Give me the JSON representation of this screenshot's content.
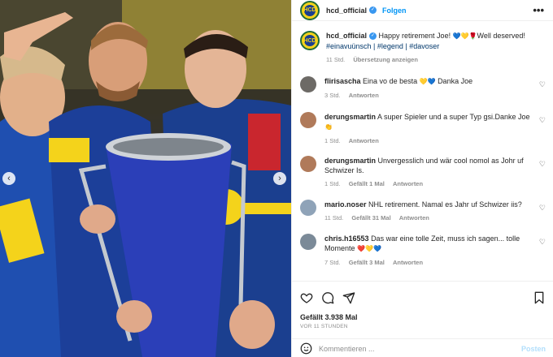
{
  "account": {
    "username": "hcd_official",
    "follow_label": "Folgen",
    "more_label": "•••",
    "avatar_initials": "HCD"
  },
  "photo": {
    "alt": "Hockey players celebrating with trophy",
    "prev_label": "‹",
    "next_label": "›"
  },
  "caption": {
    "username": "hcd_official",
    "text": "Happy retirement Joe!",
    "emojis": "💙💛🌹",
    "text2": "Well deserved!",
    "hashtags": "#einavuünsch | #legend | #davoser",
    "time": "11 Std.",
    "translate_label": "Übersetzung anzeigen"
  },
  "comments": [
    {
      "username": "flirisascha",
      "text": "Eina vo de besta",
      "emojis": "💛💙",
      "text2": "Danka Joe",
      "time": "3 Std.",
      "likes": "",
      "reply_label": "Antworten"
    },
    {
      "username": "derungsmartin",
      "text": "A super Spieler und a super Typ gsi.Danke Joe",
      "emojis": "👏",
      "text2": "",
      "time": "1 Std.",
      "likes": "",
      "reply_label": "Antworten"
    },
    {
      "username": "derungsmartin",
      "text": "Unvergesslich und wär cool nomol as Johr uf Schwizer Is.",
      "emojis": "",
      "text2": "",
      "time": "1 Std.",
      "likes": "Gefällt 1 Mal",
      "reply_label": "Antworten"
    },
    {
      "username": "mario.noser",
      "text": "NHL retirement. Namal es Jahr uf Schwizer iis?",
      "emojis": "",
      "text2": "",
      "time": "11 Std.",
      "likes": "Gefällt 31 Mal",
      "reply_label": "Antworten"
    },
    {
      "username": "chris.h16553",
      "text": "Das war eine tolle Zeit, muss ich sagen... tolle Momente",
      "emojis": "❤️💛💙",
      "text2": "",
      "time": "7 Std.",
      "likes": "Gefällt 3 Mal",
      "reply_label": "Antworten"
    }
  ],
  "footer": {
    "likes": "Gefällt 3.938 Mal",
    "timestamp": "VOR 11 STUNDEN",
    "comment_placeholder": "Kommentieren ...",
    "post_label": "Posten"
  },
  "colors": {
    "accent": "#0095f6",
    "post_disabled": "#b2dffc",
    "davos_blue": "#1b3f8f",
    "davos_yellow": "#f4d31b"
  }
}
